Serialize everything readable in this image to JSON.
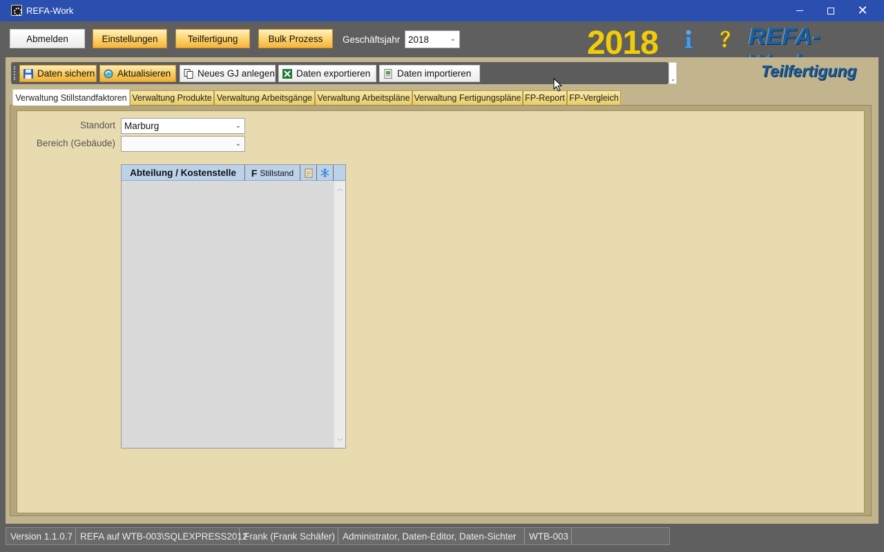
{
  "window": {
    "title": "REFA-Work"
  },
  "topbar": {
    "buttons": {
      "logout": "Abmelden",
      "settings": "Einstellungen",
      "partial_production": "Teilfertigung",
      "bulk_process": "Bulk Prozess"
    },
    "fiscal_year_label": "Geschäftsjahr",
    "fiscal_year_value": "2018",
    "year_display": "2018",
    "brand": "REFA-Work",
    "icons": {
      "info": "info-icon",
      "help": "help-icon"
    }
  },
  "toolbar": {
    "save": "Daten sichern",
    "refresh": "Aktualisieren",
    "new_fy": "Neues GJ anlegen",
    "export": "Daten exportieren",
    "import": "Daten importieren"
  },
  "section_title": "Teilfertigung",
  "tabs": [
    {
      "label": "Verwaltung Stillstandfaktoren",
      "active": true
    },
    {
      "label": "Verwaltung Produkte"
    },
    {
      "label": "Verwaltung Arbeitsgänge"
    },
    {
      "label": "Verwaltung Arbeitspläne"
    },
    {
      "label": "Verwaltung Fertigungspläne"
    },
    {
      "label": "FP-Report"
    },
    {
      "label": "FP-Vergleich"
    }
  ],
  "form": {
    "location_label": "Standort",
    "location_value": "Marburg",
    "area_label": "Bereich (Gebäude)",
    "area_value": ""
  },
  "grid": {
    "columns": {
      "department": "Abteilung / Kostenstelle",
      "factor_prefix": "F",
      "factor": "Stillstand"
    },
    "rows": []
  },
  "statusbar": {
    "version": "Version 1.1.0.7",
    "connection": "REFA auf WTB-003\\SQLEXPRESS2012",
    "user": "Frank (Frank Schäfer)",
    "roles": "Administrator, Daten-Editor, Daten-Sichter",
    "machine": "WTB-003"
  },
  "colors": {
    "titlebar": "#2b4fae",
    "accent_gold": "#f2cd07",
    "brand_blue": "#1e5fa0",
    "panel": "#e8dbb0"
  }
}
